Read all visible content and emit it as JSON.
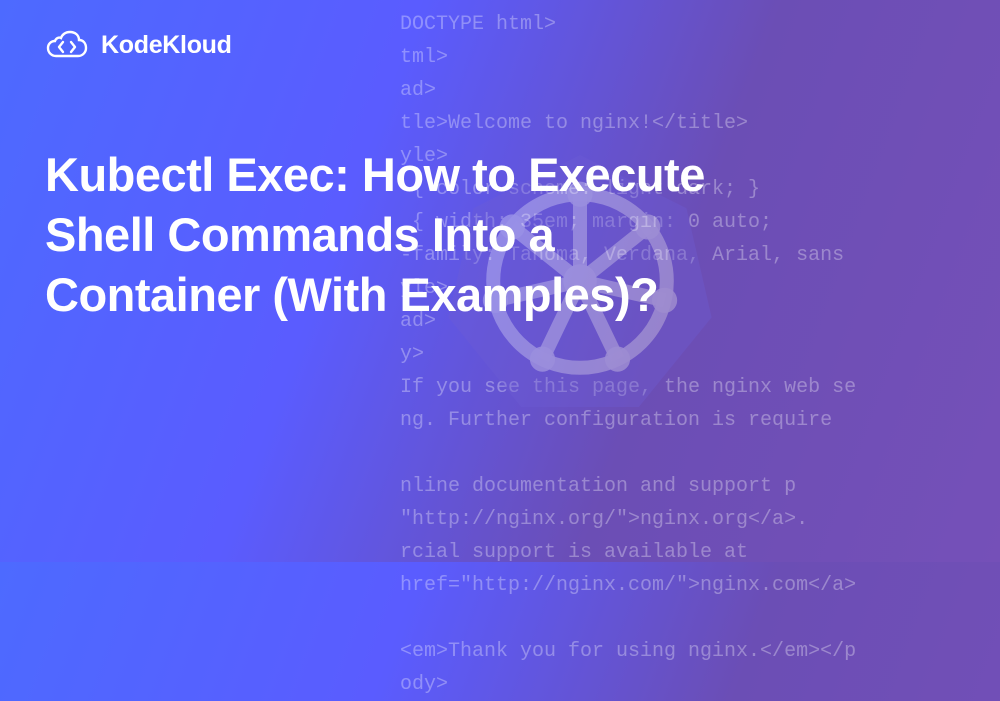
{
  "logo": {
    "text": "KodeKloud"
  },
  "heading": "Kubectl Exec: How to Execute Shell Commands Into a Container (With Examples)?",
  "bgCode": {
    "line1": "DOCTYPE html>",
    "line2": "tml>",
    "line3": "ad>",
    "line4": "tle>Welcome to nginx!</title>",
    "line5": "yle>",
    "line6": " { color-scheme: light dark; }",
    "line7": " { width: 35em; margin: 0 auto;",
    "line8": "-family: Tahoma, Verdana, Arial, sans",
    "line9": "yle>",
    "line10": "ad>",
    "line11": "y>",
    "line12": "If you see this page, the nginx web se",
    "line13": "ng. Further configuration is require",
    "line14": "",
    "line15": "nline documentation and support p",
    "line16": "\"http://nginx.org/\">nginx.org</a>.",
    "line17": "rcial support is available at",
    "line18": "href=\"http://nginx.com/\">nginx.com</a>",
    "line19": "",
    "line20": "<em>Thank you for using nginx.</em></p",
    "line21": "ody>"
  }
}
